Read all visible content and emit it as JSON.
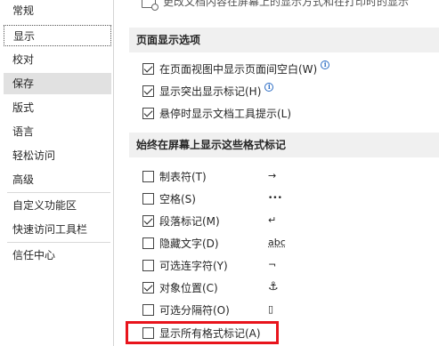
{
  "sidebar": {
    "items": [
      {
        "label": "常规"
      },
      {
        "label": "显示"
      },
      {
        "label": "校对"
      },
      {
        "label": "保存"
      },
      {
        "label": "版式"
      },
      {
        "label": "语言"
      },
      {
        "label": "轻松访问"
      },
      {
        "label": "高级"
      },
      {
        "label": "自定义功能区"
      },
      {
        "label": "快速访问工具栏"
      },
      {
        "label": "信任中心"
      }
    ],
    "selected": "显示",
    "hovered": "保存"
  },
  "main": {
    "top_partial": "更改文档内容在屏幕上的显示方式和在打印时的显示",
    "section1": {
      "title": "页面显示选项",
      "options": [
        {
          "label": "在页面视图中显示页面间空白(W)",
          "checked": true
        },
        {
          "label": "显示突出显示标记(H)",
          "checked": true
        },
        {
          "label": "悬停时显示文档工具提示(L)",
          "checked": true
        }
      ]
    },
    "section2": {
      "title": "始终在屏幕上显示这些格式标记",
      "options": [
        {
          "label": "制表符(T)",
          "checked": false,
          "symbol": "→"
        },
        {
          "label": "空格(S)",
          "checked": false,
          "symbol": "•••"
        },
        {
          "label": "段落标记(M)",
          "checked": true,
          "symbol": "↵"
        },
        {
          "label": "隐藏文字(D)",
          "checked": false,
          "symbol": "abc"
        },
        {
          "label": "可选连字符(Y)",
          "checked": false,
          "symbol": "¬"
        },
        {
          "label": "对象位置(C)",
          "checked": true,
          "symbol": "⚓"
        },
        {
          "label": "可选分隔符(O)",
          "checked": false,
          "symbol": "▯"
        },
        {
          "label": "显示所有格式标记(A)",
          "checked": false
        }
      ]
    }
  },
  "colors": {
    "highlight": "#e8141c",
    "info": "#2b6cc4",
    "header_bg": "#f0f0f0"
  }
}
